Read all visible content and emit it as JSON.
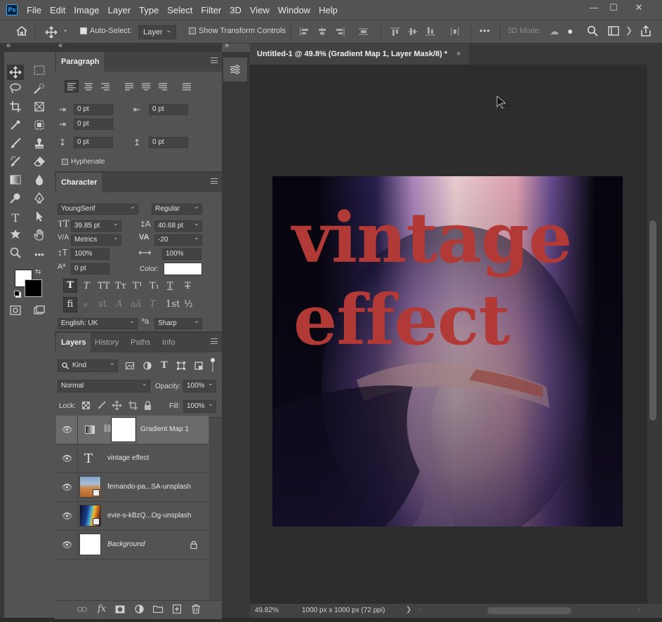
{
  "app": {
    "logo_text": "Ps"
  },
  "menu": [
    "File",
    "Edit",
    "Image",
    "Layer",
    "Type",
    "Select",
    "Filter",
    "3D",
    "View",
    "Window",
    "Help"
  ],
  "window_controls": {
    "minimize": "—",
    "maximize": "☐",
    "close": "✕"
  },
  "options": {
    "auto_select_label": "Auto-Select:",
    "auto_select_checked": true,
    "auto_select_target": "Layer",
    "show_transform_label": "Show Transform Controls",
    "show_transform_checked": false,
    "more_label": "•••",
    "mode_3d_label": "3D Mode:"
  },
  "collapse_arrows": {
    "left": "«",
    "mid": "«",
    "right": "»"
  },
  "paragraph": {
    "tab": "Paragraph",
    "indent_left": "0 pt",
    "indent_right": "0 pt",
    "indent_first": "0 pt",
    "space_before": "0 pt",
    "space_after": "0 pt",
    "hyphenate_label": "Hyphenate",
    "hyphenate_checked": false
  },
  "character": {
    "tab": "Character",
    "font_family": "YoungSerif",
    "font_style": "Regular",
    "font_size": "39.85 pt",
    "leading": "40.68 pt",
    "kerning": "Metrics",
    "tracking": "-20",
    "vertical_scale": "100%",
    "horizontal_scale": "100%",
    "baseline_shift": "0 pt",
    "color_label": "Color:",
    "color_value": "#ffffff",
    "style_buttons": [
      "T",
      "T",
      "TT",
      "Tт",
      "T¹",
      "T₁",
      "T",
      "T"
    ],
    "opentype_buttons": [
      "fi",
      "ℴ",
      "st",
      "A",
      "aā",
      "T",
      "1st",
      "½"
    ],
    "language": "English: UK",
    "aa_icon": "ªa",
    "antialias": "Sharp"
  },
  "layers_panel": {
    "tabs": [
      "Layers",
      "History",
      "Paths",
      "Info"
    ],
    "filter_kind": "Kind",
    "blend_mode": "Normal",
    "opacity_label": "Opacity:",
    "opacity": "100%",
    "lock_label": "Lock:",
    "fill_label": "Fill:",
    "fill": "100%",
    "layers": [
      {
        "name": "Gradient Map 1",
        "type": "adjustment",
        "selected": true,
        "visible": true
      },
      {
        "name": "vintage effect",
        "type": "text",
        "selected": false,
        "visible": true
      },
      {
        "name": "fernando-pa...SA-unsplash",
        "type": "smart",
        "selected": false,
        "visible": true
      },
      {
        "name": "evie-s-kBzQ...Og-unsplash",
        "type": "smart",
        "selected": false,
        "visible": true
      },
      {
        "name": "Background",
        "type": "background",
        "selected": false,
        "visible": true,
        "locked": true
      }
    ],
    "text_layer_glyph": "T",
    "footer_icons": [
      "link-icon",
      "fx-icon",
      "mask-icon",
      "adjustment-icon",
      "folder-icon",
      "new-layer-icon",
      "trash-icon"
    ],
    "footer_fx": "fx"
  },
  "document": {
    "tab_title": "Untitled-1 @ 49.8% (Gradient Map 1, Layer Mask/8) *",
    "close_glyph": "×",
    "canvas_text_line1": "vintage",
    "canvas_text_line2": "effect",
    "zoom": "49.82%",
    "doc_info": "1000 px x 1000 px (72 ppi)",
    "status_arrow": "❯",
    "text_color": "#b23a36"
  }
}
